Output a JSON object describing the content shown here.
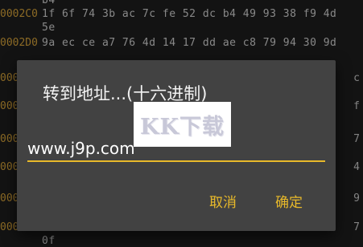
{
  "hex_view": {
    "rows": [
      {
        "addr": "",
        "bytes": "b4",
        "side": ""
      },
      {
        "addr": "0002C0",
        "bytes": "1f 6f 74 3b ac 7c fe 52 dc b4 49 93 38 f9 4d",
        "side": ""
      },
      {
        "addr": "",
        "bytes": "5e",
        "side": ""
      },
      {
        "addr": "0002D0",
        "bytes": "9a ec ce a7 76 4d 14 17 dd ae c8 79 94 30 9d",
        "side": ""
      },
      {
        "addr": "",
        "bytes": "",
        "side": ""
      },
      {
        "addr": "000",
        "bytes": "",
        "side": "c"
      },
      {
        "addr": "",
        "bytes": "",
        "side": ""
      },
      {
        "addr": "000",
        "bytes": "",
        "side": "f"
      },
      {
        "addr": "",
        "bytes": "",
        "side": ""
      },
      {
        "addr": "000",
        "bytes": "",
        "side": "7"
      },
      {
        "addr": "",
        "bytes": "",
        "side": ""
      },
      {
        "addr": "000",
        "bytes": "",
        "side": "4"
      },
      {
        "addr": "",
        "bytes": "",
        "side": ""
      },
      {
        "addr": "000",
        "bytes": "",
        "side": "9"
      },
      {
        "addr": "",
        "bytes": "",
        "side": ""
      },
      {
        "addr": "000",
        "bytes": "",
        "side": "7"
      },
      {
        "addr": "",
        "bytes": "0f",
        "side": ""
      }
    ]
  },
  "dialog": {
    "title": "转到地址...(十六进制)",
    "watermark": "KK下载",
    "input_value": "www.j9p.com",
    "cancel_label": "取消",
    "ok_label": "确定"
  },
  "colors": {
    "accent": "#e8b92a",
    "dialog_bg": "#424242",
    "address": "#d7a43a"
  }
}
